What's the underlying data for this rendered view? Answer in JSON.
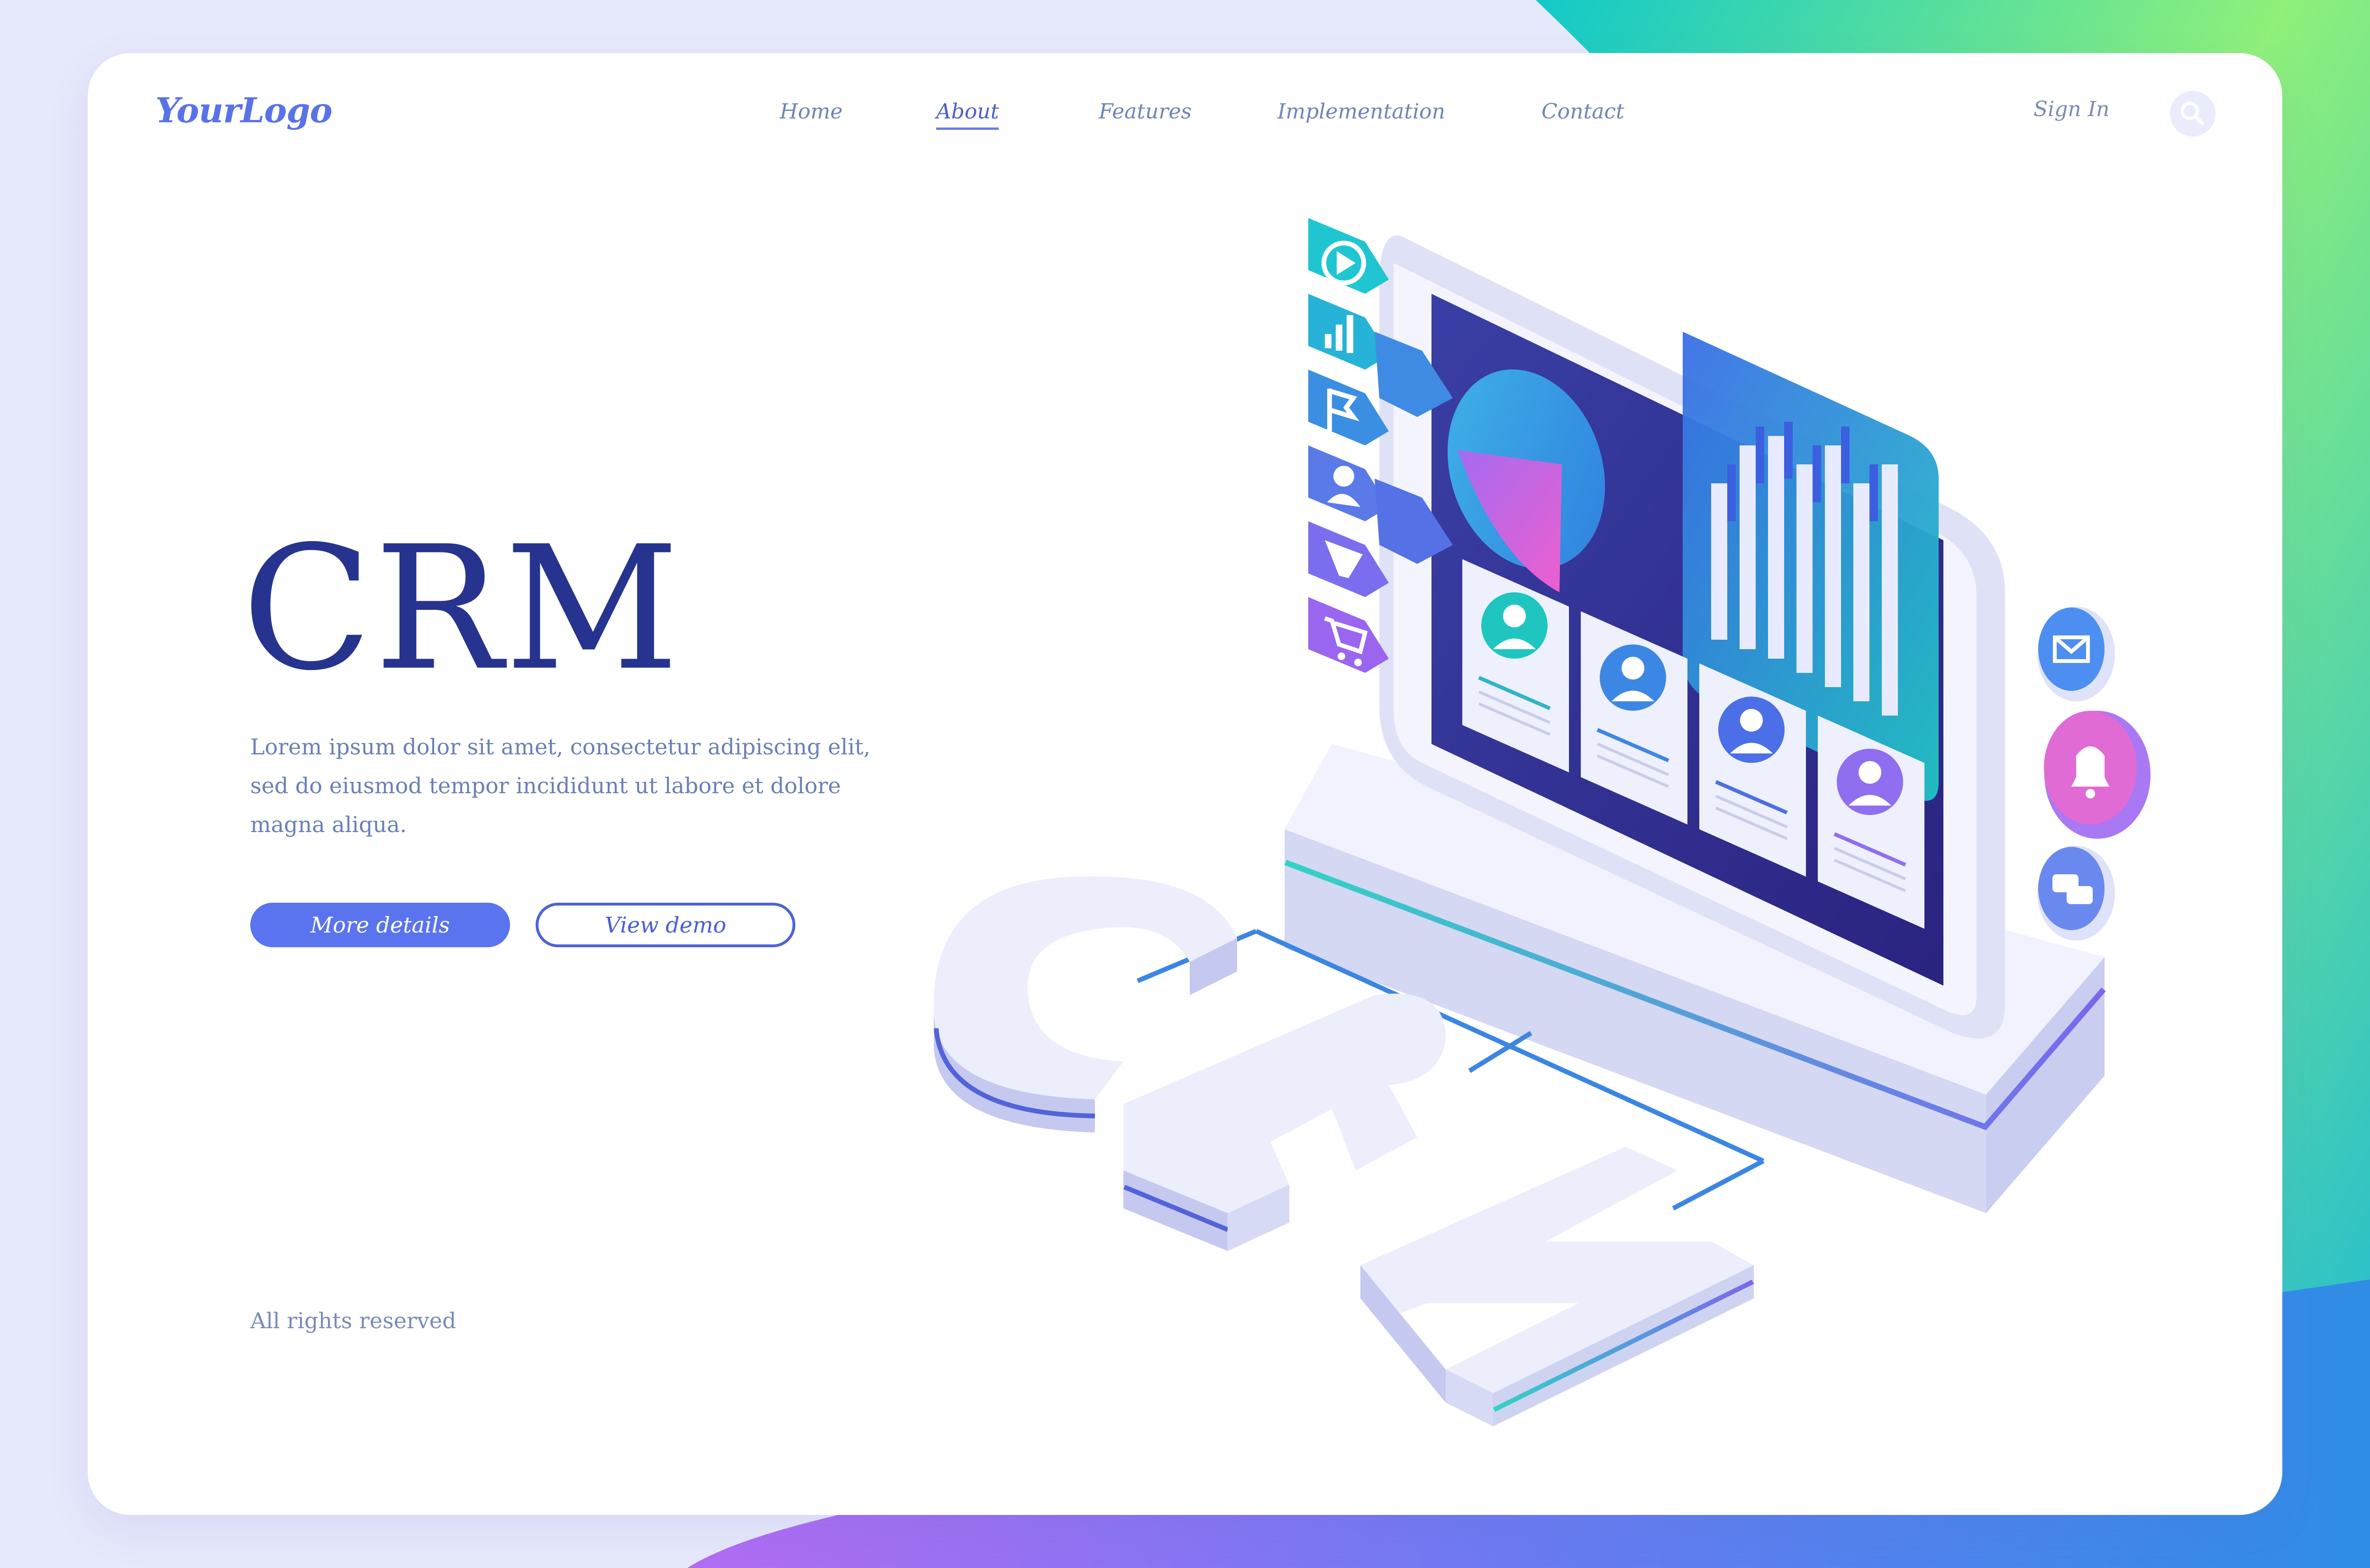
{
  "brand": {
    "logo": "YourLogo"
  },
  "nav": {
    "items": [
      {
        "label": "Home",
        "active": false
      },
      {
        "label": "About",
        "active": true
      },
      {
        "label": "Features",
        "active": false
      },
      {
        "label": "Implementation",
        "active": false
      },
      {
        "label": "Contact",
        "active": false
      }
    ],
    "sign_in": "Sign In",
    "search_icon": "search-icon"
  },
  "hero": {
    "title": "CRM",
    "description": "Lorem ipsum dolor sit amet, consectetur adipiscing elit, sed do eiusmod tempor incididunt ut labore et dolore magna aliqua.",
    "primary_button": "More details",
    "secondary_button": "View demo"
  },
  "illustration": {
    "word": "CRM",
    "side_icons": [
      "play-icon",
      "bar-chart-icon",
      "flag-icon",
      "user-icon",
      "funnel-icon",
      "cart-icon"
    ],
    "right_icons": [
      "mail-icon",
      "bell-icon",
      "chat-icon"
    ],
    "contact_cards": 4
  },
  "footer": {
    "text": "All rights reserved"
  },
  "colors": {
    "accent": "#5a73ee",
    "title": "#26348f",
    "text": "#6b80b4",
    "screen": "#2e2f8f",
    "gradient_start": "#1fd0c8",
    "gradient_end": "#a56bf0"
  }
}
